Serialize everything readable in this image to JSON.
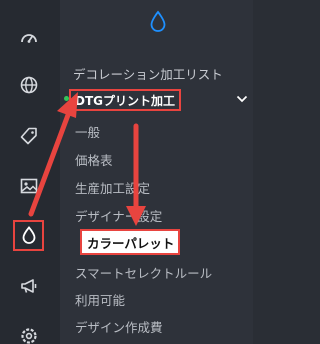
{
  "sidebar": {
    "icons": [
      "dashboard-icon",
      "globe-icon",
      "tag-icon",
      "image-icon",
      "drop-icon",
      "megaphone-icon",
      "settings-icon"
    ],
    "active": "drop-icon"
  },
  "menu": {
    "section_title": "デコレーション加工リスト",
    "expanded_item": "DTGプリント加工",
    "sub_items": [
      "一般",
      "価格表",
      "生産加工設定",
      "デザイナー設定",
      "カラーパレット",
      "スマートセレクトルール",
      "利用可能",
      "デザイン作成費"
    ],
    "highlighted_sub_item": "カラーパレット"
  },
  "colors": {
    "accent": "#1e90ff",
    "highlight": "#e8443f",
    "status_dot": "#34c759"
  }
}
